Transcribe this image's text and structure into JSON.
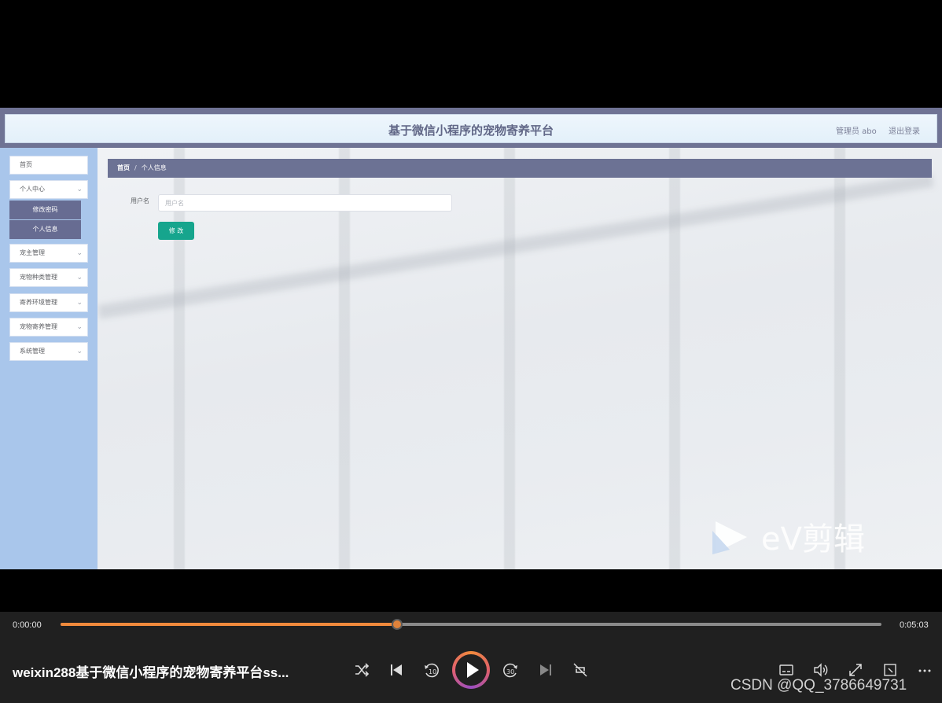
{
  "app": {
    "title": "基于微信小程序的宠物寄养平台",
    "admin_label": "管理员 abo",
    "logout": "退出登录"
  },
  "sidebar": {
    "items": [
      {
        "label": "首页",
        "has_children": false
      },
      {
        "label": "个人中心",
        "has_children": true
      },
      {
        "label": "宠主管理",
        "has_children": true
      },
      {
        "label": "宠物种类管理",
        "has_children": true
      },
      {
        "label": "寄养环境管理",
        "has_children": true
      },
      {
        "label": "宠物寄养管理",
        "has_children": true
      },
      {
        "label": "系统管理",
        "has_children": true
      }
    ],
    "submenu": [
      "修改密码",
      "个人信息"
    ],
    "active_submenu": "个人信息"
  },
  "breadcrumb": {
    "home": "首页",
    "separator": "/",
    "current": "个人信息"
  },
  "form": {
    "username_label": "用户名",
    "username_placeholder": "用户名",
    "username_value": "",
    "submit_label": "修 改"
  },
  "watermark": {
    "text": "eV剪辑"
  },
  "player": {
    "elapsed": "0:00:00",
    "duration": "0:05:03",
    "progress_fraction": 0.41,
    "file_title": "weixin288基于微信小程序的宠物寄养平台ss...",
    "icons": [
      "shuffle-icon",
      "previous-icon",
      "skip-back-10-icon",
      "play-icon",
      "skip-forward-30-icon",
      "next-icon",
      "repeat-icon",
      "subtitles-icon",
      "volume-icon",
      "fullscreen-icon",
      "mini-player-icon",
      "more-icon"
    ],
    "accent_color": "#f08a3c"
  },
  "watermark_csdn": "CSDN @QQ_3786649731",
  "colors": {
    "header_bg": "#e6f2fb",
    "sidebar_bg": "#a9c6eb",
    "breadcrumb_bg": "#6c7294",
    "submenu_bg": "#676c92",
    "button_bg": "#16a58d",
    "frame_border": "#6f7394"
  }
}
